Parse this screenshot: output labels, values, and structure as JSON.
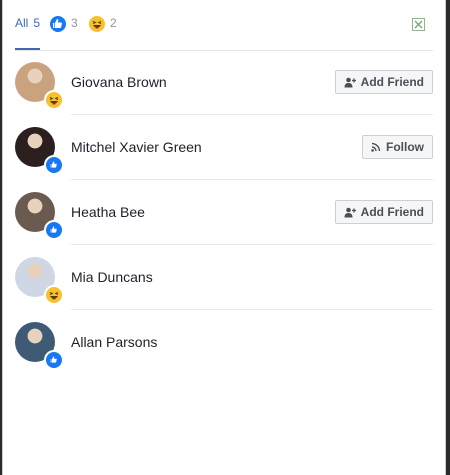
{
  "tabs": {
    "all": {
      "label": "All",
      "count": "5"
    },
    "like": {
      "count": "3",
      "icon": "like-icon"
    },
    "haha": {
      "count": "2",
      "icon": "haha-icon"
    }
  },
  "close_icon": "close-icon",
  "people": [
    {
      "name": "Giovana Brown",
      "reaction": "haha",
      "action": "Add Friend",
      "action_icon": "add-friend-icon",
      "avatar_color": "#c9a37d"
    },
    {
      "name": "Mitchel Xavier Green",
      "reaction": "like",
      "action": "Follow",
      "action_icon": "rss-icon",
      "avatar_color": "#2b1f1f"
    },
    {
      "name": "Heatha Bee",
      "reaction": "like",
      "action": "Add Friend",
      "action_icon": "add-friend-icon",
      "avatar_color": "#6b5a4f"
    },
    {
      "name": "Mia Duncans",
      "reaction": "haha",
      "action": "",
      "action_icon": "",
      "avatar_color": "#cfd6e4"
    },
    {
      "name": "Allan Parsons",
      "reaction": "like",
      "action": "",
      "action_icon": "",
      "avatar_color": "#3f5a74"
    }
  ],
  "colors": {
    "accent": "#4267b2",
    "like": "#1877f2",
    "haha": "#f7c12d"
  }
}
